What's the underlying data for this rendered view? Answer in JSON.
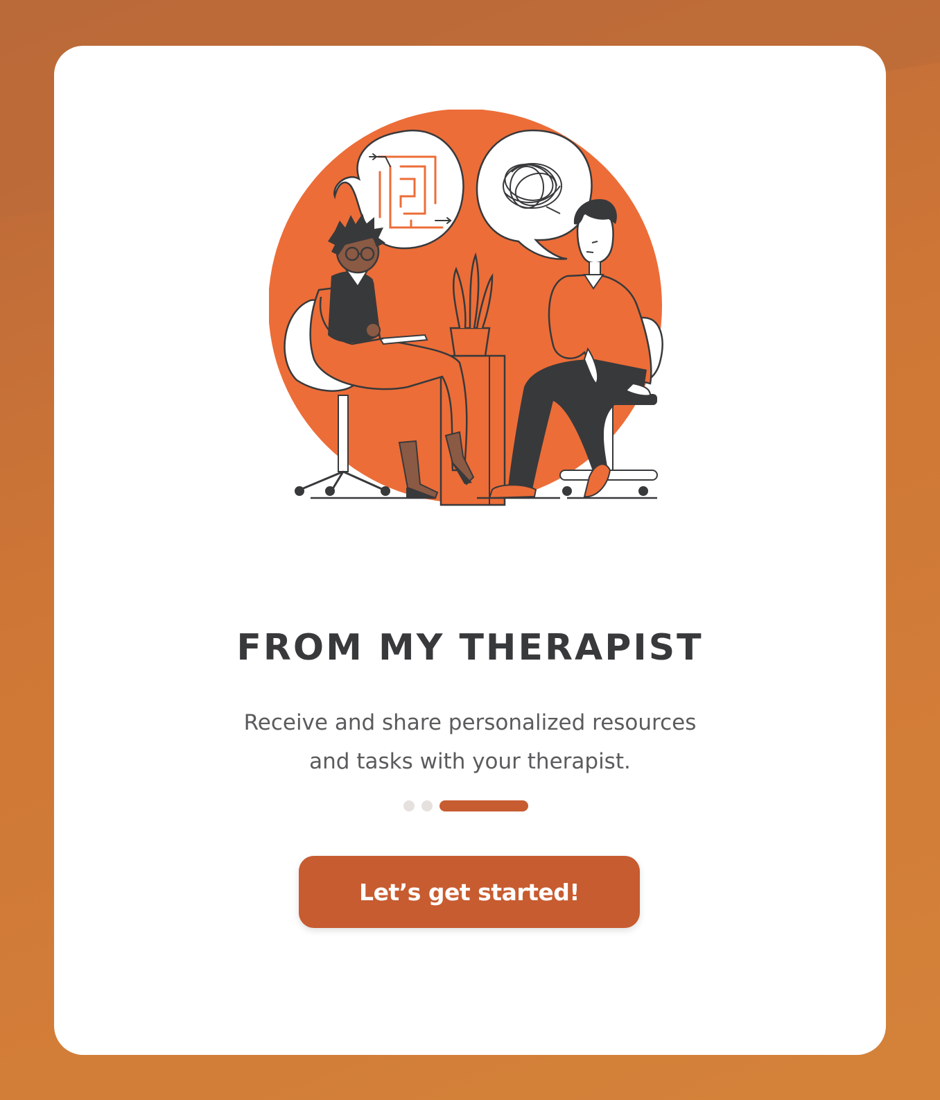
{
  "onboarding": {
    "title": "FROM MY THERAPIST",
    "description": "Receive and share personalized resources and tasks with your therapist.",
    "pagination": {
      "total": 3,
      "active_index": 2
    },
    "cta_label": "Let’s get started!",
    "illustration_icon": "therapy-session-illustration"
  },
  "colors": {
    "accent": "#c75c30",
    "illustration_orange": "#ec6d38",
    "background_start": "#b9673a",
    "background_end": "#d4823a",
    "card": "#ffffff",
    "title_text": "#38393b",
    "body_text": "#5b5b5d",
    "dot_inactive": "#e6e1df"
  }
}
